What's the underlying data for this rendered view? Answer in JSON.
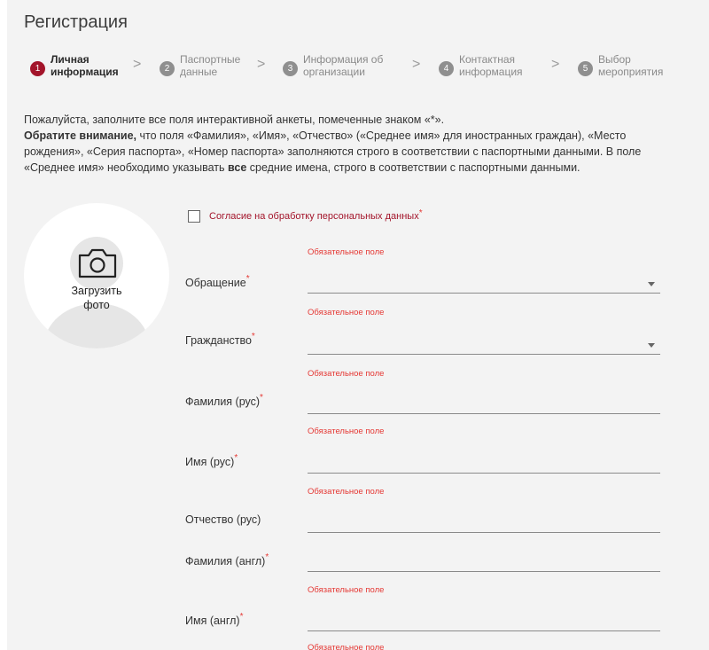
{
  "page": {
    "title": "Регистрация"
  },
  "steps": [
    {
      "num": "1",
      "line1": "Личная",
      "line2": "информация"
    },
    {
      "num": "2",
      "line1": "Паспортные",
      "line2": "данные"
    },
    {
      "num": "3",
      "line1": "Информация об",
      "line2": "организации"
    },
    {
      "num": "4",
      "line1": "Контактная",
      "line2": "информация"
    },
    {
      "num": "5",
      "line1": "Выбор",
      "line2": "мероприятия"
    }
  ],
  "chevron": ">",
  "intro": {
    "line1": "Пожалуйста, заполните все поля интерактивной анкеты, помеченные знаком «*».",
    "attention_bold": "Обратите внимание,",
    "line2_rest": " что поля «Фамилия», «Имя», «Отчество» («Среднее имя» для иностранных граждан), «Место рождения», «Серия паспорта», «Номер паспорта» заполняются строго в соответствии с паспортными данными. В поле «Среднее имя» необходимо указывать ",
    "all_bold": "все",
    "line3_rest": " средние имена, строго в соответствии с паспортными данными."
  },
  "photo": {
    "line1": "Загрузить",
    "line2": "фото"
  },
  "consent": {
    "label": "Согласие на обработку персональных данных"
  },
  "required_mark": "*",
  "error_text": "Обязательное поле",
  "fields": {
    "salutation": {
      "label": "Обращение"
    },
    "citizenship": {
      "label": "Гражданство"
    },
    "surname_ru": {
      "label": "Фамилия (рус)"
    },
    "name_ru": {
      "label": "Имя (рус)"
    },
    "patronymic_ru": {
      "label": "Отчество (рус)"
    },
    "surname_en": {
      "label": "Фамилия (англ)"
    },
    "name_en": {
      "label": "Имя (англ)"
    }
  },
  "colors": {
    "accent": "#a3142a",
    "error": "#e53935",
    "panel_bg": "#f3f3f3"
  }
}
